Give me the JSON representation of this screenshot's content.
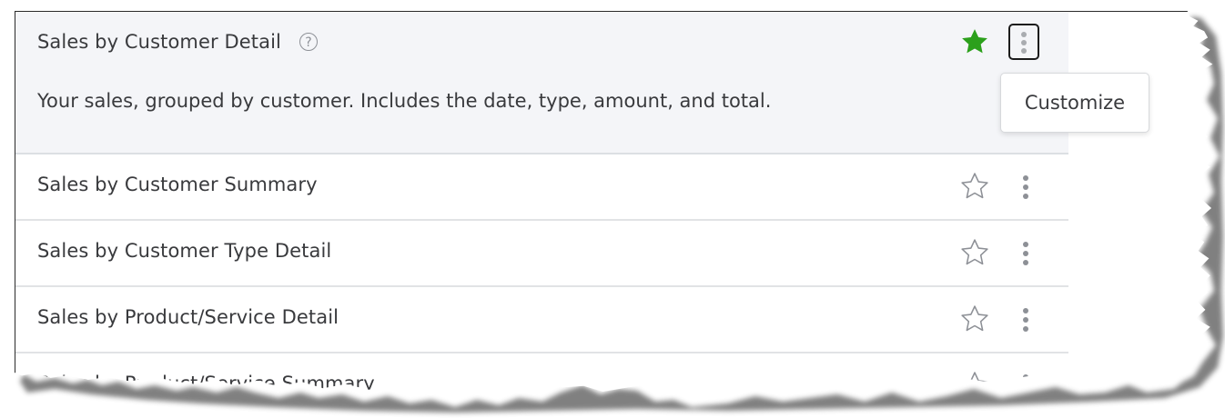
{
  "reports": [
    {
      "title": "Sales by Customer Detail",
      "description": "Your sales, grouped by customer. Includes the date, type, amount, and total.",
      "favorite": true,
      "expanded": true
    },
    {
      "title": "Sales by Customer Summary",
      "favorite": false
    },
    {
      "title": "Sales by Customer Type Detail",
      "favorite": false
    },
    {
      "title": "Sales by Product/Service Detail",
      "favorite": false
    },
    {
      "title": "Sales by Product/Service Summary",
      "favorite": false
    }
  ],
  "help_glyph": "?",
  "menu": {
    "customize_label": "Customize"
  },
  "colors": {
    "favorite_star": "#2ca01c",
    "empty_star_outline": "#8d9096",
    "highlight_row_bg": "#f4f5f8",
    "text": "#393a3d"
  },
  "icons": {
    "favorite": "star-filled-icon",
    "not_favorite": "star-outline-icon",
    "more": "kebab-menu-icon",
    "help": "help-circle-icon"
  }
}
